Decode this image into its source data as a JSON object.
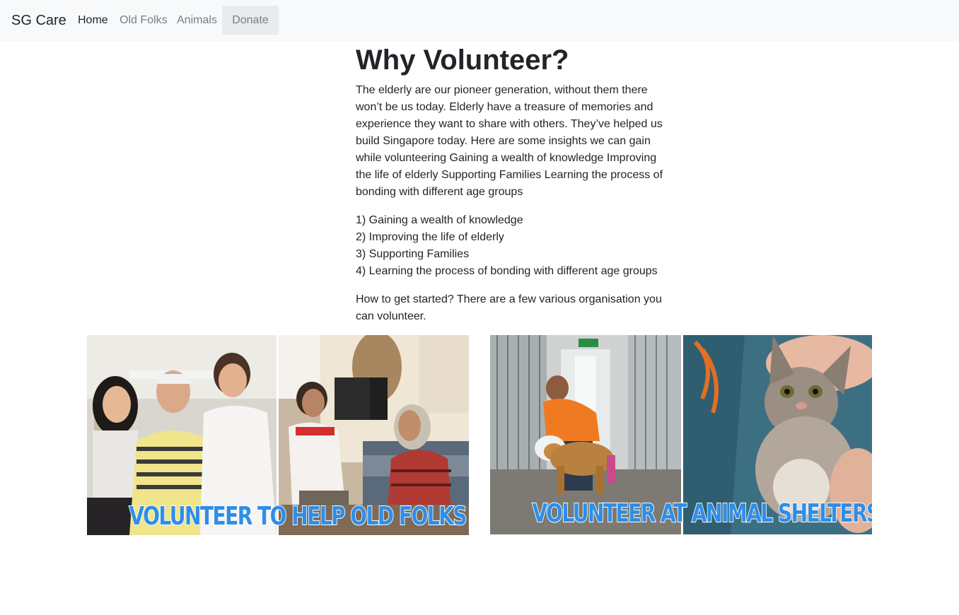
{
  "navbar": {
    "brand": "SG Care",
    "links": [
      {
        "label": "Home",
        "active": true
      },
      {
        "label": "Old Folks",
        "active": false
      },
      {
        "label": "Animals",
        "active": false
      }
    ],
    "donate_label": "Donate"
  },
  "main": {
    "title": "Why Volunteer?",
    "intro": "The elderly are our pioneer generation, without them there won’t be us today. Elderly have a treasure of memories and experience they want to share with others. They’ve helped us build Singapore today. Here are some insights we can gain while volunteering Gaining a wealth of knowledge Improving the life of elderly Supporting Families Learning the process of bonding with different age groups",
    "insights": [
      "1) Gaining a wealth of knowledge",
      "2) Improving the life of elderly",
      "3) Supporting Families",
      "4) Learning the process of bonding with different age groups"
    ],
    "outro": "How to get started? There are a few various organisation you can volunteer."
  },
  "cards": [
    {
      "caption": "VOLUNTEER TO HELP OLD FOLKS",
      "icon": "old-folks-photo"
    },
    {
      "caption": "VOLUNTEER AT ANIMAL SHELTERS",
      "icon": "animal-shelter-photo"
    }
  ],
  "colors": {
    "navbar_bg": "#f8f9fa",
    "caption_blue": "#2f8ee6",
    "text": "#212529",
    "muted_link": "#7a7d80"
  }
}
